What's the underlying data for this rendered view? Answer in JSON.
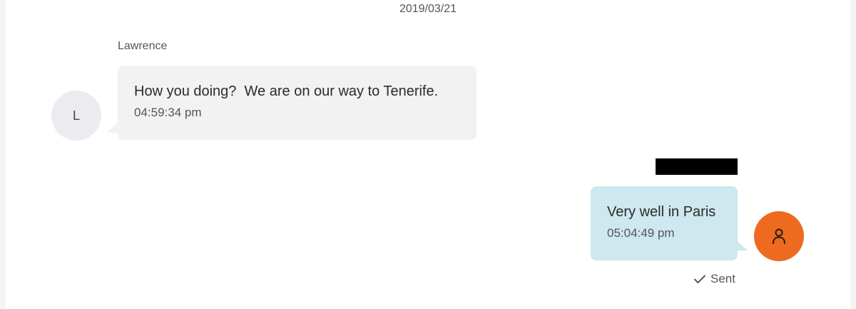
{
  "conversation": {
    "date": "2019/03/21",
    "messages": [
      {
        "direction": "incoming",
        "sender": "Lawrence",
        "avatar_initial": "L",
        "text": "How you doing?  We are on our way to Tenerife.",
        "time": "04:59:34 pm"
      },
      {
        "direction": "outgoing",
        "sender_redacted": true,
        "avatar_icon": "user-icon",
        "text": "Very well in Paris",
        "time": "05:04:49 pm",
        "status": "Sent",
        "status_icon": "check-icon"
      }
    ]
  },
  "colors": {
    "incoming_bubble": "#f2f2f2",
    "outgoing_bubble": "#cde8ee",
    "outgoing_avatar": "#ee6a1f",
    "incoming_avatar": "#ececf0"
  }
}
